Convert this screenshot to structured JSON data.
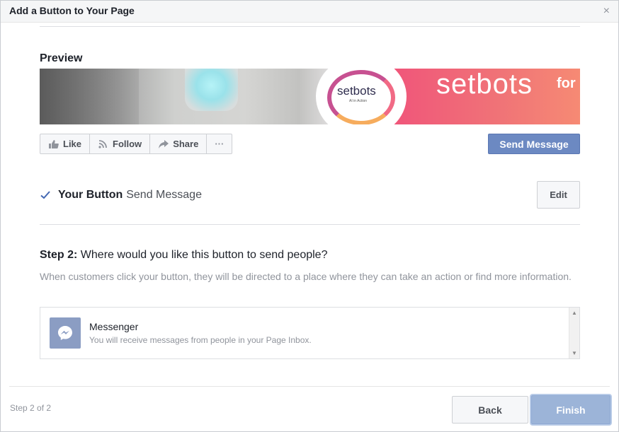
{
  "dialog": {
    "title": "Add a Button to Your Page",
    "close_icon": "close-icon",
    "close_glyph": "×"
  },
  "preview": {
    "label": "Preview",
    "cover": {
      "logo_text": "setbots",
      "logo_subtext": "AI in Action",
      "brand_text": "setbots",
      "brand_suffix": "for"
    },
    "actions": [
      {
        "label": "Like",
        "icon": "thumbs-up-icon"
      },
      {
        "label": "Follow",
        "icon": "rss-icon"
      },
      {
        "label": "Share",
        "icon": "share-arrow-icon"
      },
      {
        "label": "···",
        "icon": "more-icon"
      }
    ],
    "send_message_label": "Send Message"
  },
  "your_button": {
    "label": "Your Button",
    "value": "Send Message",
    "check_icon": "checkmark-icon",
    "edit_label": "Edit"
  },
  "step2": {
    "prefix": "Step 2:",
    "question": "Where would you like this button to send people?",
    "description": "When customers click your button, they will be directed to a place where they can take an action or find more information."
  },
  "destinations": [
    {
      "name": "Messenger",
      "subtitle": "You will receive messages from people in your Page Inbox.",
      "icon": "messenger-icon"
    }
  ],
  "footer": {
    "step_indicator": "Step 2 of 2",
    "back_label": "Back",
    "finish_label": "Finish"
  },
  "colors": {
    "primary_button": "#6c89c2",
    "finish_disabled": "#9cb4d8",
    "messenger_tile": "#8b9dc3",
    "check": "#4267b2"
  }
}
